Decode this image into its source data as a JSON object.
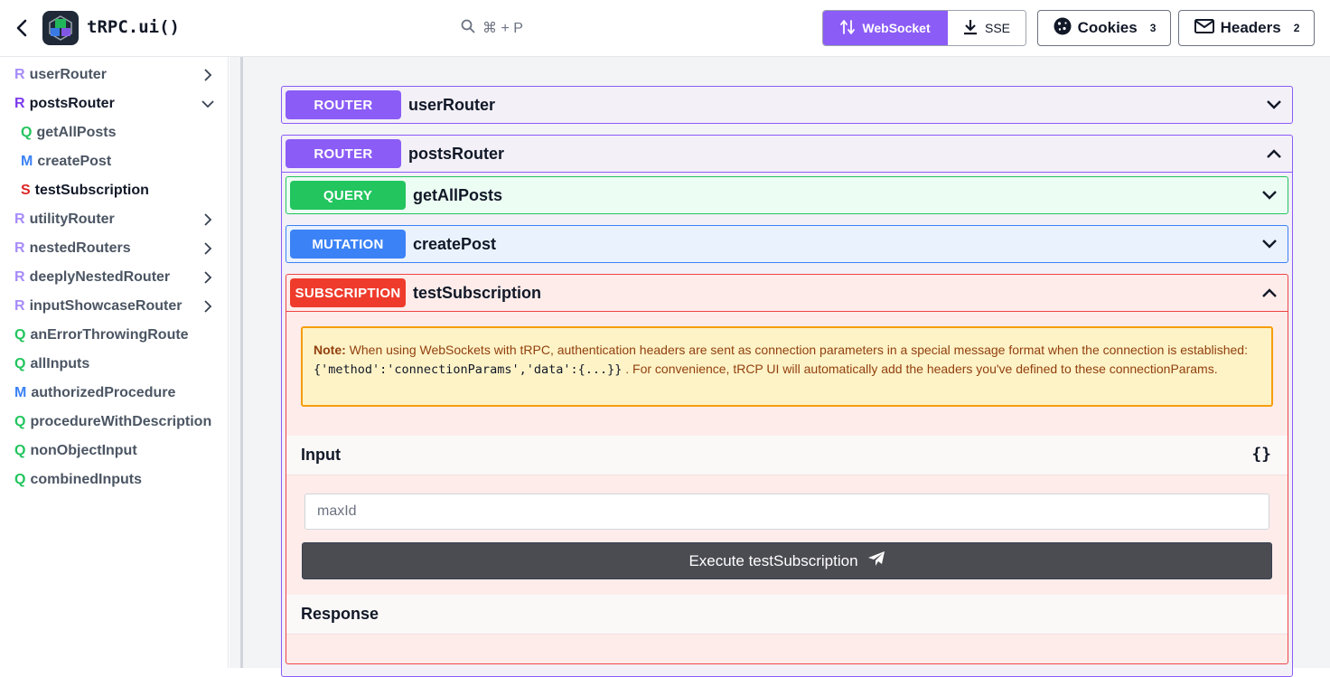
{
  "app": {
    "title": "tRPC.ui()"
  },
  "search": {
    "shortcut": "⌘ + P"
  },
  "transport": {
    "websocket_label": "WebSocket",
    "sse_label": "SSE",
    "active": "WebSocket"
  },
  "cookies": {
    "label": "Cookies",
    "count": "3"
  },
  "headers": {
    "label": "Headers",
    "count": "2"
  },
  "sidebar": {
    "items": [
      {
        "letter": "R",
        "label": "userRouter",
        "expanded": false
      },
      {
        "letter": "R",
        "label": "postsRouter",
        "expanded": true
      },
      {
        "letter": "Q",
        "label": "getAllPosts"
      },
      {
        "letter": "M",
        "label": "createPost"
      },
      {
        "letter": "S",
        "label": "testSubscription"
      },
      {
        "letter": "R",
        "label": "utilityRouter"
      },
      {
        "letter": "R",
        "label": "nestedRouters"
      },
      {
        "letter": "R",
        "label": "deeplyNestedRouter"
      },
      {
        "letter": "R",
        "label": "inputShowcaseRouter"
      },
      {
        "letter": "Q",
        "label": "anErrorThrowingRoute"
      },
      {
        "letter": "Q",
        "label": "allInputs"
      },
      {
        "letter": "M",
        "label": "authorizedProcedure"
      },
      {
        "letter": "Q",
        "label": "procedureWithDescription"
      },
      {
        "letter": "Q",
        "label": "nonObjectInput"
      },
      {
        "letter": "Q",
        "label": "combinedInputs"
      }
    ]
  },
  "main": {
    "routers": [
      {
        "badge": "ROUTER",
        "name": "userRouter"
      },
      {
        "badge": "ROUTER",
        "name": "postsRouter"
      }
    ],
    "procedures": [
      {
        "badge": "QUERY",
        "name": "getAllPosts"
      },
      {
        "badge": "MUTATION",
        "name": "createPost"
      },
      {
        "badge": "SUBSCRIPTION",
        "name": "testSubscription"
      }
    ],
    "note": {
      "label": "Note:",
      "text1": " When using WebSockets with tRPC, authentication headers are sent as connection parameters in a special message format when the connection is established: ",
      "code": "{'method':'connectionParams','data':{...}}",
      "text2": " . For convenience, tRCP UI will automatically add the headers you've defined to these connectionParams."
    },
    "input": {
      "title": "Input",
      "braces": "{}",
      "placeholder": "maxId"
    },
    "execute_label": "Execute testSubscription",
    "response_title": "Response"
  },
  "colors": {
    "router": "#8b5cf6",
    "query": "#22c55e",
    "mutation": "#3b82f6",
    "subscription": "#ef4444",
    "note_bg": "#fef3c7"
  }
}
